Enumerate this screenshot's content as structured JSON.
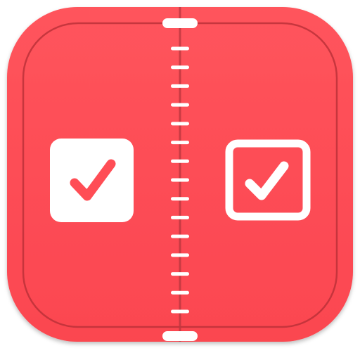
{
  "icon": {
    "name": "split-checkbox-app-icon",
    "colors": {
      "base": "#ff4d55",
      "base_edge": "#e84049",
      "inner_line": "#b92f37",
      "divider": "#c03840",
      "glyph": "#ffffff"
    },
    "left_checkbox": {
      "style": "filled",
      "checked": true
    },
    "right_checkbox": {
      "style": "outlined",
      "checked": true
    },
    "ruler_tick_count": 15
  }
}
